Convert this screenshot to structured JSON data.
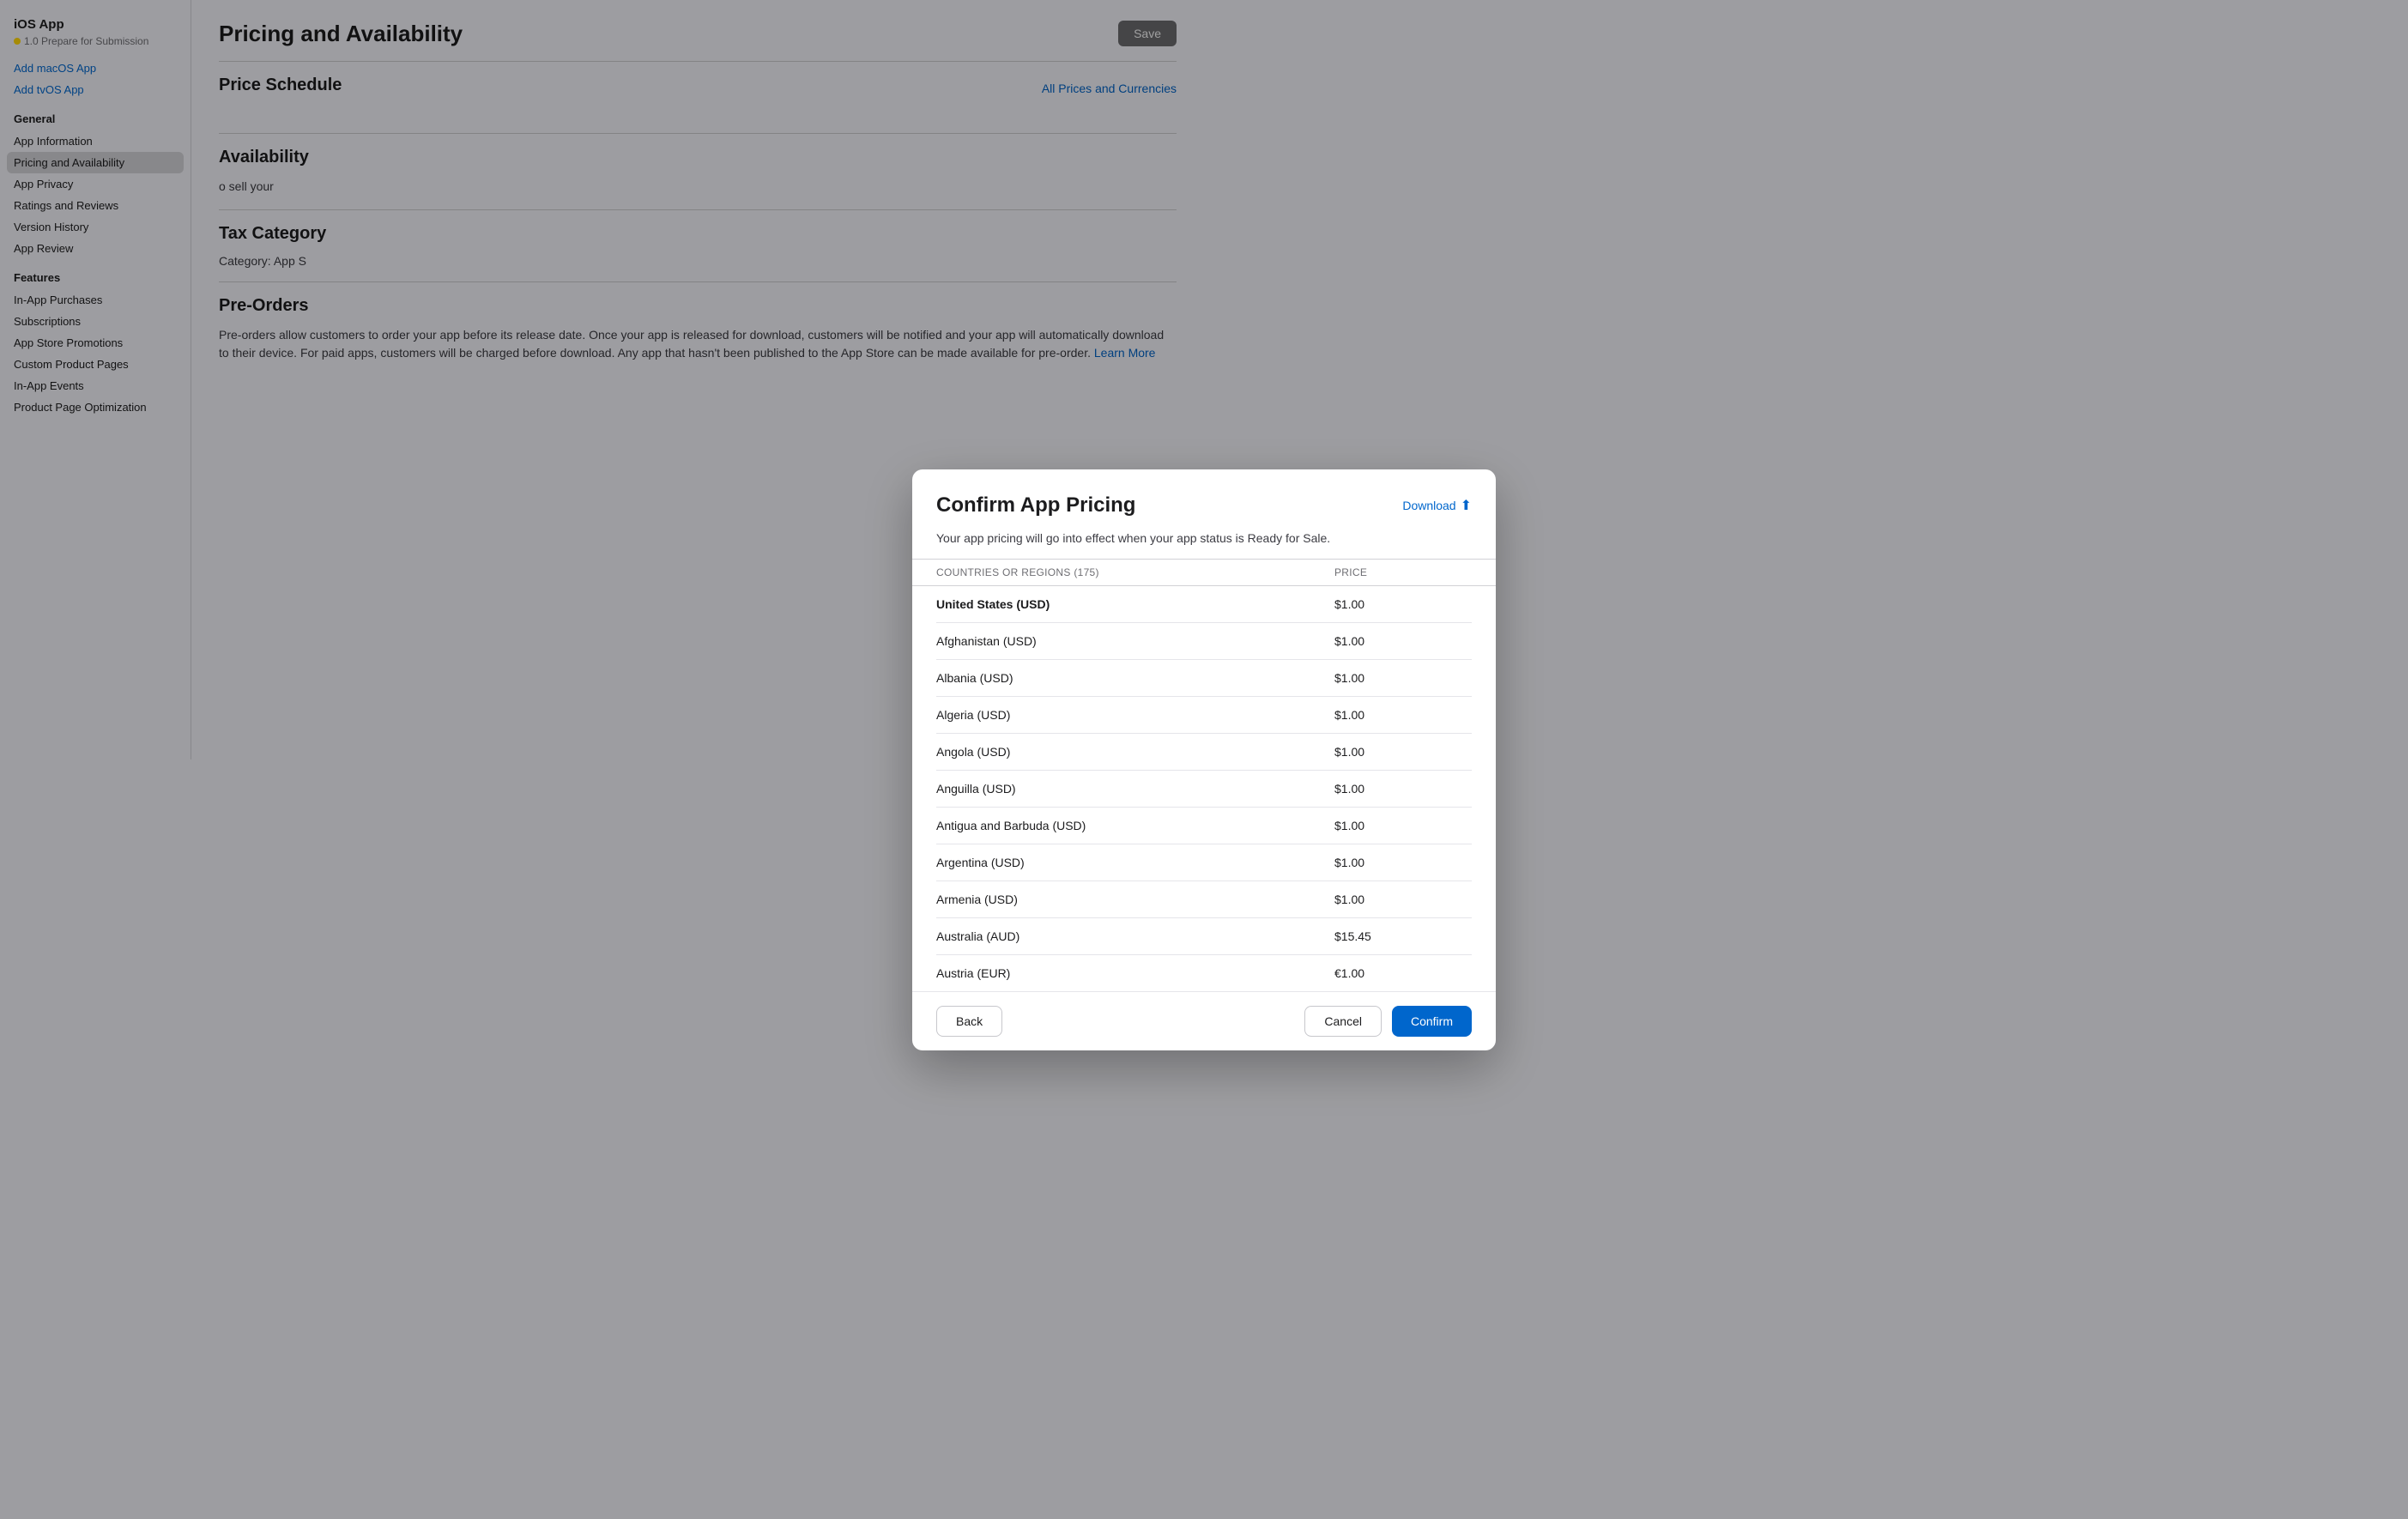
{
  "app": {
    "title": "iOS App",
    "subtitle": "1.0 Prepare for Submission"
  },
  "sidebar": {
    "add_macos_label": "Add macOS App",
    "add_tvos_label": "Add tvOS App",
    "general_label": "General",
    "features_label": "Features",
    "items": {
      "app_information": "App Information",
      "pricing_availability": "Pricing and Availability",
      "app_privacy": "App Privacy",
      "ratings_reviews": "Ratings and Reviews",
      "version_history": "Version History",
      "app_review": "App Review",
      "in_app_purchases": "In-App Purchases",
      "subscriptions": "Subscriptions",
      "app_store_promotions": "App Store Promotions",
      "custom_product_pages": "Custom Product Pages",
      "in_app_events": "In-App Events",
      "product_page_optimization": "Product Page Optimization"
    }
  },
  "main": {
    "page_title": "Pricing and Availability",
    "save_button": "Save",
    "price_schedule_heading": "Price Schedule",
    "all_prices_link": "All Prices and Currencies",
    "availability_heading": "Availability",
    "availability_text": "o sell your",
    "tax_category_heading": "Tax Category",
    "tax_category_text": "Category: App S",
    "pre_orders_heading": "Pre-Orders",
    "pre_orders_text": "Pre-orders allow customers to order your app before its release date. Once your app is released for download, customers will be notified and your app will automatically download to their device. For paid apps, customers will be charged before download. Any app that hasn't been published to the App Store can be made available for pre-order.",
    "learn_more": "Learn More"
  },
  "modal": {
    "title": "Confirm App Pricing",
    "download_label": "Download",
    "subtitle": "Your app pricing will go into effect when your app status is Ready for Sale.",
    "table_header": {
      "country_col": "COUNTRIES OR REGIONS (175)",
      "price_col": "PRICE"
    },
    "rows": [
      {
        "country": "United States (USD)",
        "price": "$1.00",
        "bold": true
      },
      {
        "country": "Afghanistan (USD)",
        "price": "$1.00",
        "bold": false
      },
      {
        "country": "Albania (USD)",
        "price": "$1.00",
        "bold": false
      },
      {
        "country": "Algeria (USD)",
        "price": "$1.00",
        "bold": false
      },
      {
        "country": "Angola (USD)",
        "price": "$1.00",
        "bold": false
      },
      {
        "country": "Anguilla (USD)",
        "price": "$1.00",
        "bold": false
      },
      {
        "country": "Antigua and Barbuda (USD)",
        "price": "$1.00",
        "bold": false
      },
      {
        "country": "Argentina (USD)",
        "price": "$1.00",
        "bold": false
      },
      {
        "country": "Armenia (USD)",
        "price": "$1.00",
        "bold": false
      },
      {
        "country": "Australia (AUD)",
        "price": "$15.45",
        "bold": false
      },
      {
        "country": "Austria (EUR)",
        "price": "€1.00",
        "bold": false
      }
    ],
    "back_button": "Back",
    "cancel_button": "Cancel",
    "confirm_button": "Confirm"
  }
}
